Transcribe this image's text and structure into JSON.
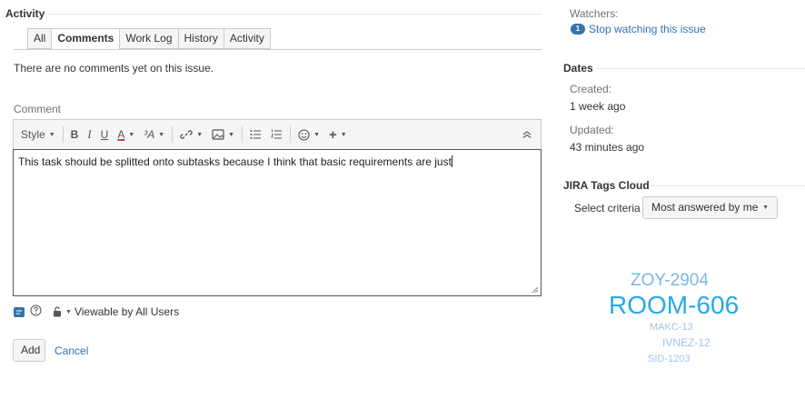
{
  "activity": {
    "title": "Activity",
    "tabs": [
      {
        "label": "All",
        "active": false
      },
      {
        "label": "Comments",
        "active": true
      },
      {
        "label": "Work Log",
        "active": false
      },
      {
        "label": "History",
        "active": false
      },
      {
        "label": "Activity",
        "active": false
      }
    ],
    "empty_message": "There are no comments yet on this issue."
  },
  "comment": {
    "label": "Comment",
    "toolbar": {
      "style_label": "Style",
      "bold": "B",
      "italic": "I",
      "underline": "U",
      "text_color": "A",
      "text_size": "³A",
      "link_icon": "link-icon",
      "image_icon": "image-icon",
      "bullet_list_icon": "bullet-list-icon",
      "numbered_list_icon": "numbered-list-icon",
      "emoticon_icon": "emoticon-icon",
      "insert_more": "+",
      "collapse_icon": "collapse-icon"
    },
    "text": "This task should be splitted onto subtasks because I think that basic requirements are just",
    "visibility": "Viewable by All Users",
    "add_label": "Add",
    "cancel_label": "Cancel"
  },
  "sidebar": {
    "watchers": {
      "label": "Watchers:",
      "count": "1",
      "action": "Stop watching this issue"
    },
    "dates": {
      "title": "Dates",
      "created_label": "Created:",
      "created_value": "1 week ago",
      "updated_label": "Updated:",
      "updated_value": "43 minutes ago"
    },
    "tags_cloud": {
      "title": "JIRA Tags Cloud",
      "criteria_label": "Select criteria",
      "criteria_value": "Most answered by me",
      "tags": [
        "ZOY-2904",
        "ROOM-606",
        "MAKC-13",
        "IVNEZ-12",
        "SID-1203"
      ]
    }
  },
  "colors": {
    "link": "#3572b0",
    "text_color_underline": "#d04437",
    "tag_large": "#29a8ea",
    "tag_medium": "#7bb7e8",
    "tag_small": "#9fc3eb"
  }
}
